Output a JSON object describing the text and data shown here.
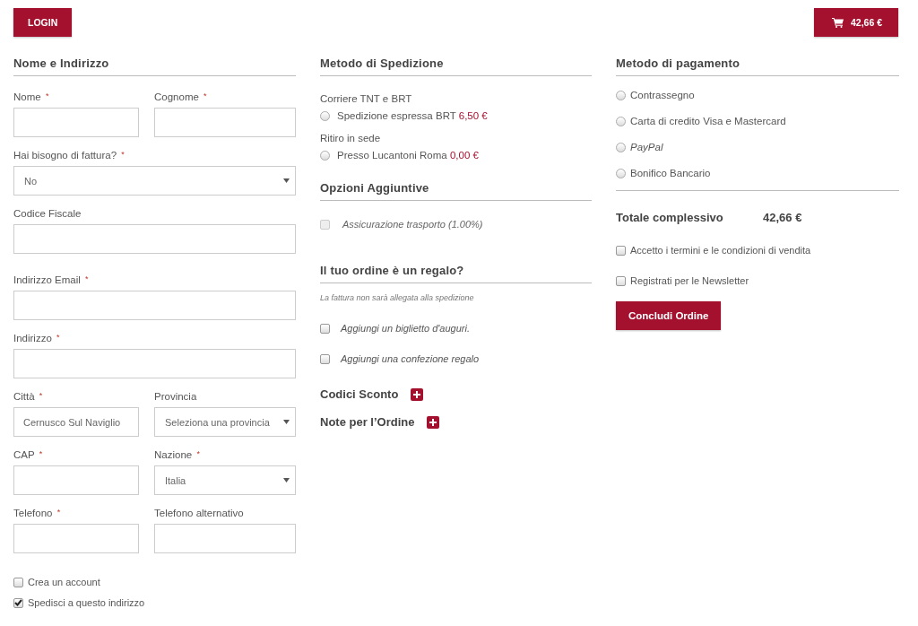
{
  "login_button": "LOGIN",
  "cart": {
    "total": "42,66 €"
  },
  "address": {
    "title": "Nome e Indirizzo",
    "rows": [
      [
        {
          "label": "Nome",
          "required_mark": "*",
          "kind": "text"
        },
        {
          "label": "Cognome",
          "required_mark": "*",
          "kind": "text"
        }
      ],
      [
        {
          "label": "Hai bisogno di fattura?",
          "required_mark": "*",
          "kind": "select",
          "value": "No"
        }
      ],
      [
        {
          "label": "Codice Fiscale",
          "kind": "text"
        }
      ],
      [
        {
          "label": "Indirizzo Email",
          "required_mark": "*",
          "kind": "text"
        }
      ],
      [
        {
          "label": "Indirizzo",
          "required_mark": "*",
          "kind": "text"
        }
      ],
      [
        {
          "label": "Città",
          "required_mark": "*",
          "kind": "text",
          "placeholder": "Cernusco Sul Naviglio"
        },
        {
          "label": "Provincia",
          "kind": "select",
          "value": "Seleziona una provincia"
        }
      ],
      [
        {
          "label": "CAP",
          "required_mark": "*",
          "kind": "text"
        },
        {
          "label": "Nazione",
          "required_mark": "*",
          "kind": "select",
          "value": "Italia"
        }
      ],
      [
        {
          "label": "Telefono",
          "required_mark": "*",
          "kind": "text"
        },
        {
          "label": "Telefono alternativo",
          "kind": "text"
        }
      ]
    ],
    "checkboxes": [
      {
        "label": "Crea un account",
        "checked": false
      },
      {
        "label": "Spedisci a questo indirizzo",
        "checked": true
      }
    ]
  },
  "shipping": {
    "title": "Metodo di Spedizione",
    "groups": [
      {
        "name": "Corriere TNT e BRT",
        "options": [
          {
            "label": "Spedizione espressa BRT",
            "price": "6,50 €",
            "selected": false
          }
        ]
      },
      {
        "name": "Ritiro in sede",
        "options": [
          {
            "label": "Presso Lucantoni Roma",
            "price": "0,00 €",
            "selected": false
          }
        ]
      }
    ]
  },
  "extras": {
    "title": "Opzioni Aggiuntive",
    "options": [
      {
        "label": "Assicurazione trasporto (1.00%)",
        "checked": false,
        "disabled": true
      }
    ]
  },
  "gift": {
    "title": "Il tuo ordine è un regalo?",
    "note": "La fattura non sarà allegata alla spedizione",
    "options": [
      {
        "label": "Aggiungi un biglietto d'auguri.",
        "checked": false
      },
      {
        "label": "Aggiungi una confezione regalo",
        "checked": false
      }
    ]
  },
  "toggles": [
    {
      "label": "Codici Sconto",
      "expanded": false
    },
    {
      "label": "Note per l’Ordine",
      "expanded": false
    }
  ],
  "payment": {
    "title": "Metodo di pagamento",
    "methods": [
      {
        "label": "Contrassegno",
        "selected": false,
        "italic": false
      },
      {
        "label": "Carta di credito Visa e Mastercard",
        "selected": false,
        "italic": false
      },
      {
        "label": "PayPal",
        "selected": false,
        "italic": true
      },
      {
        "label": "Bonifico Bancario",
        "selected": false,
        "italic": false
      }
    ]
  },
  "summary": {
    "label": "Totale complessivo",
    "value": "42,66 €"
  },
  "agreements": [
    {
      "label": "Accetto i termini e le condizioni di vendita",
      "checked": false
    },
    {
      "label": "Registrati per le Newsletter",
      "checked": false
    }
  ],
  "submit_button": "Concludi Ordine"
}
